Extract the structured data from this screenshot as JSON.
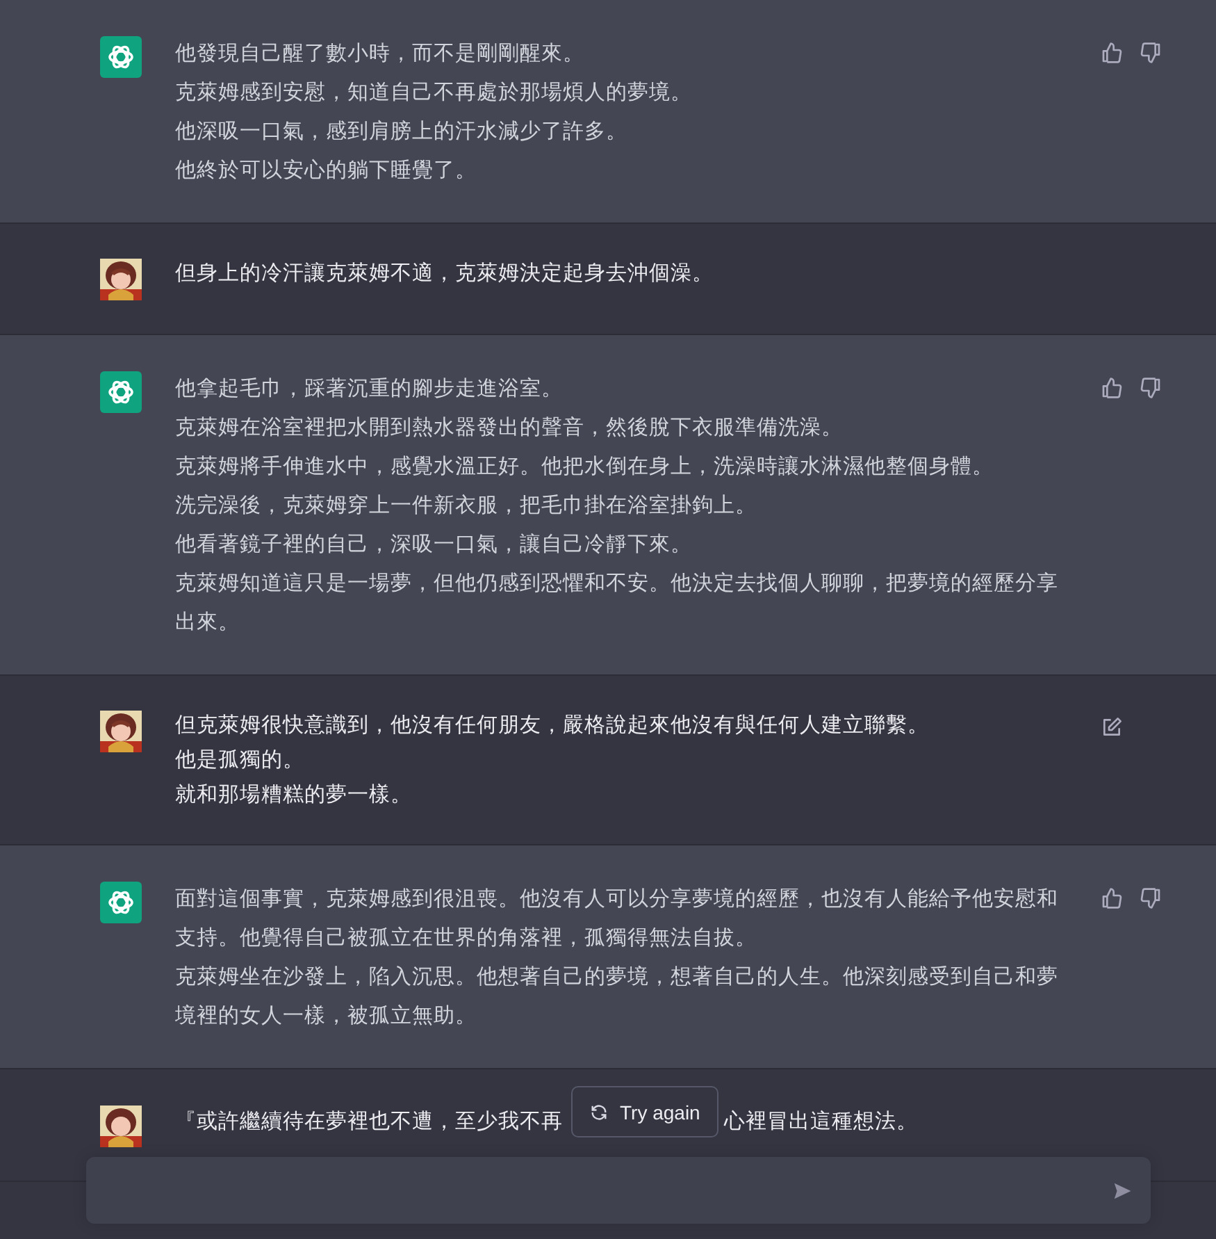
{
  "messages": [
    {
      "kind": "assistant",
      "paragraphs": [
        "他發現自己醒了數小時，而不是剛剛醒來。",
        "克萊姆感到安慰，知道自己不再處於那場煩人的夢境。",
        "他深吸一口氣，感到肩膀上的汗水減少了許多。",
        "他終於可以安心的躺下睡覺了。"
      ]
    },
    {
      "kind": "user",
      "editable": false,
      "paragraphs": [
        "但身上的冷汗讓克萊姆不適，克萊姆決定起身去沖個澡。"
      ]
    },
    {
      "kind": "assistant",
      "paragraphs": [
        "他拿起毛巾，踩著沉重的腳步走進浴室。",
        "克萊姆在浴室裡把水開到熱水器發出的聲音，然後脫下衣服準備洗澡。",
        "克萊姆將手伸進水中，感覺水溫正好。他把水倒在身上，洗澡時讓水淋濕他整個身體。",
        "洗完澡後，克萊姆穿上一件新衣服，把毛巾掛在浴室掛鉤上。",
        "他看著鏡子裡的自己，深吸一口氣，讓自己冷靜下來。",
        "克萊姆知道這只是一場夢，但他仍感到恐懼和不安。他決定去找個人聊聊，把夢境的經歷分享出來。"
      ]
    },
    {
      "kind": "user",
      "editable": true,
      "paragraphs": [
        "但克萊姆很快意識到，他沒有任何朋友，嚴格說起來他沒有與任何人建立聯繫。",
        "他是孤獨的。",
        "就和那場糟糕的夢一樣。"
      ]
    },
    {
      "kind": "assistant",
      "paragraphs": [
        "面對這個事實，克萊姆感到很沮喪。他沒有人可以分享夢境的經歷，也沒有人能給予他安慰和支持。他覺得自己被孤立在世界的角落裡，孤獨得無法自拔。",
        "克萊姆坐在沙發上，陷入沉思。他想著自己的夢境，想著自己的人生。他深刻感受到自己和夢境裡的女人一樣，被孤立無助。"
      ]
    }
  ],
  "last_message": {
    "line_start": "『或許繼續待在夢裡也不遭，至少我不再",
    "line_end": "心裡冒出這種想法。"
  },
  "try_again": {
    "label": "Try again"
  }
}
